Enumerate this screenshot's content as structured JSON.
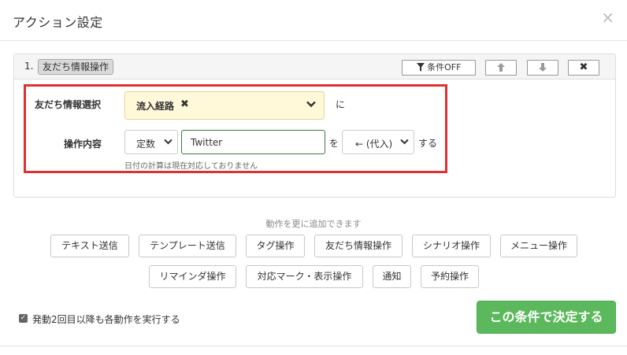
{
  "modal": {
    "title": "アクション設定",
    "close_glyph": "×"
  },
  "step": {
    "number": "1.",
    "tag": "友だち情報操作",
    "filter_label": "条件OFF",
    "up_glyph": "🡅",
    "down_glyph": "🡇",
    "delete_glyph": "✖"
  },
  "form": {
    "friend_info_label": "友だち情報選択",
    "friend_info_value": "流入経路",
    "chip_remove_glyph": "✖",
    "particle_ni": "に",
    "operation_label": "操作内容",
    "type_value": "定数",
    "input_value": "Twitter",
    "particle_wo": "を",
    "assign_value": "← (代入)",
    "suffix_suru": "する",
    "hint": "日付の計算は現在対応しておりません"
  },
  "add_actions": {
    "caption": "動作を更に追加できます",
    "row1": [
      "テキスト送信",
      "テンプレート送信",
      "タグ操作",
      "友だち情報操作",
      "シナリオ操作",
      "メニュー操作"
    ],
    "row2": [
      "リマインダ操作",
      "対応マーク・表示操作",
      "通知",
      "予約操作"
    ]
  },
  "footer": {
    "repeat_checkbox_label": "発動2回目以降も各動作を実行する",
    "repeat_checked": true,
    "submit_label": "この条件で決定する"
  },
  "colors": {
    "highlight_border": "#e03030",
    "submit_bg": "#5cb85c",
    "selected_field_bg": "#fff8d9",
    "input_focus_border": "#3c7a3c"
  },
  "icons": {
    "filter": "filter-icon",
    "up": "arrow-up-icon",
    "down": "arrow-down-icon",
    "delete": "close-icon",
    "chevron": "chevron-down-icon"
  }
}
